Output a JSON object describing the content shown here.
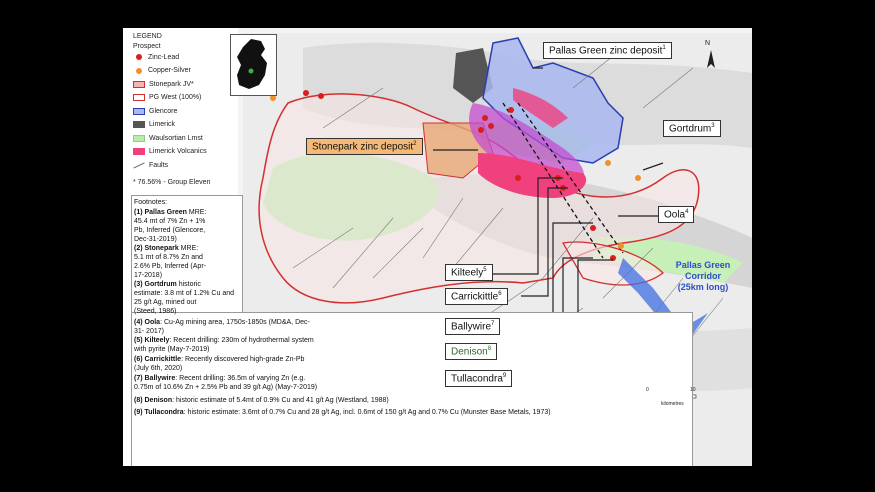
{
  "legend": {
    "title": "LEGEND",
    "subtitle": "Prospect",
    "items": [
      {
        "label": "Zinc-Lead",
        "kind": "dot",
        "color": "#d91e1e"
      },
      {
        "label": "Copper-Silver",
        "kind": "dot",
        "color": "#f28e2b"
      },
      {
        "label": "Stonepark JV*",
        "kind": "swatch",
        "color": "#f6b4b0",
        "border": "#d32f2f"
      },
      {
        "label": "PG West (100%)",
        "kind": "swatch",
        "color": "#ffffff",
        "border": "#d32f2f"
      },
      {
        "label": "Glencore",
        "kind": "swatch",
        "color": "#a9b8f0",
        "border": "#2a3fb0"
      },
      {
        "label": "Limerick",
        "kind": "swatch",
        "color": "#555555",
        "border": "#555555"
      },
      {
        "label": "Waulsortian Lmst",
        "kind": "swatch",
        "color": "#b9ecaa",
        "border": "#8fcf80"
      },
      {
        "label": "Limerick Volcanics",
        "kind": "swatch",
        "color": "#f0407e",
        "border": "#f0407e"
      },
      {
        "label": "Faults",
        "kind": "line",
        "color": "#666666"
      }
    ],
    "note": "* 76.56% - Group Eleven"
  },
  "footnotes": {
    "heading": "Footnotes:",
    "items": [
      {
        "bold": "(1) Pallas Green",
        "lines": [
          " MRE:",
          "45.4 mt of 7% Zn + 1%",
          "Pb, Inferred (Glencore,",
          "Dec-31-2019)"
        ]
      },
      {
        "bold": "(2) Stonepark",
        "lines": [
          " MRE:",
          "5.1 mt of 8.7% Zn and",
          "2.6% Pb, Inferred (Apr-",
          "17-2018)"
        ]
      },
      {
        "bold": "(3) Gortdrum",
        "lines": [
          " historic",
          "estimate: 3.8 mt of 1.2% Cu and 25 g/t Ag, mined out",
          "(Steed, 1986)"
        ]
      },
      {
        "bold": "(4) Oola",
        "lines": [
          ": Cu-Ag mining area, 1750s-1850s (MD&A, Dec-",
          "31- 2017)"
        ]
      },
      {
        "bold": "(5) Kilteely",
        "lines": [
          ": Recent drilling: 230m of hydrothermal system",
          "with pyrite (May-7-2019)"
        ]
      },
      {
        "bold": "(6) Carrickittle",
        "lines": [
          ": Recently discovered high-grade Zn-Pb",
          "(July 6th, 2020)"
        ]
      },
      {
        "bold": "(7) Ballywire",
        "lines": [
          ": Recent drilling: 36.5m of varying Zn (e.g.",
          "0.75m of 10.6% Zn + 2.5% Pb and 39 g/t Ag) (May-7-2019)"
        ]
      },
      {
        "bold": "(8) Denison",
        "lines": [
          ": historic estimate of 5.4mt of 0.9% Cu and 41 g/t Ag (Westland, 1988)"
        ]
      },
      {
        "bold": "(9) Tullacondra",
        "lines": [
          ": historic estimate: 3.6mt of 0.7% Cu and 28 g/t Ag, incl. 0.6mt of 150 g/t Ag and 0.7% Cu (Munster Base Metals, 1973)"
        ]
      }
    ]
  },
  "callouts": {
    "pallas": {
      "text": "Pallas Green zinc deposit",
      "sup": "1"
    },
    "stonepark": {
      "text": "Stonepark zinc deposit",
      "sup": "2"
    },
    "gortdrum": {
      "text": "Gortdrum",
      "sup": "3"
    },
    "oola": {
      "text": "Oola",
      "sup": "4"
    },
    "kilteely": {
      "text": "Kilteely",
      "sup": "5"
    },
    "carrickittle": {
      "text": "Carrickittle",
      "sup": "6"
    },
    "ballywire": {
      "text": "Ballywire",
      "sup": "7"
    },
    "denison": {
      "text": "Denison",
      "sup": "8"
    },
    "tullacondra": {
      "text": "Tullacondra",
      "sup": "9"
    }
  },
  "corridor": {
    "line1": "Pallas Green",
    "line2": "Corridor",
    "line3": "(25km long)",
    "color": "#2b4fc8"
  },
  "scale": {
    "zero": "0",
    "ten": "10",
    "unit": "kilometres"
  },
  "north": "N"
}
